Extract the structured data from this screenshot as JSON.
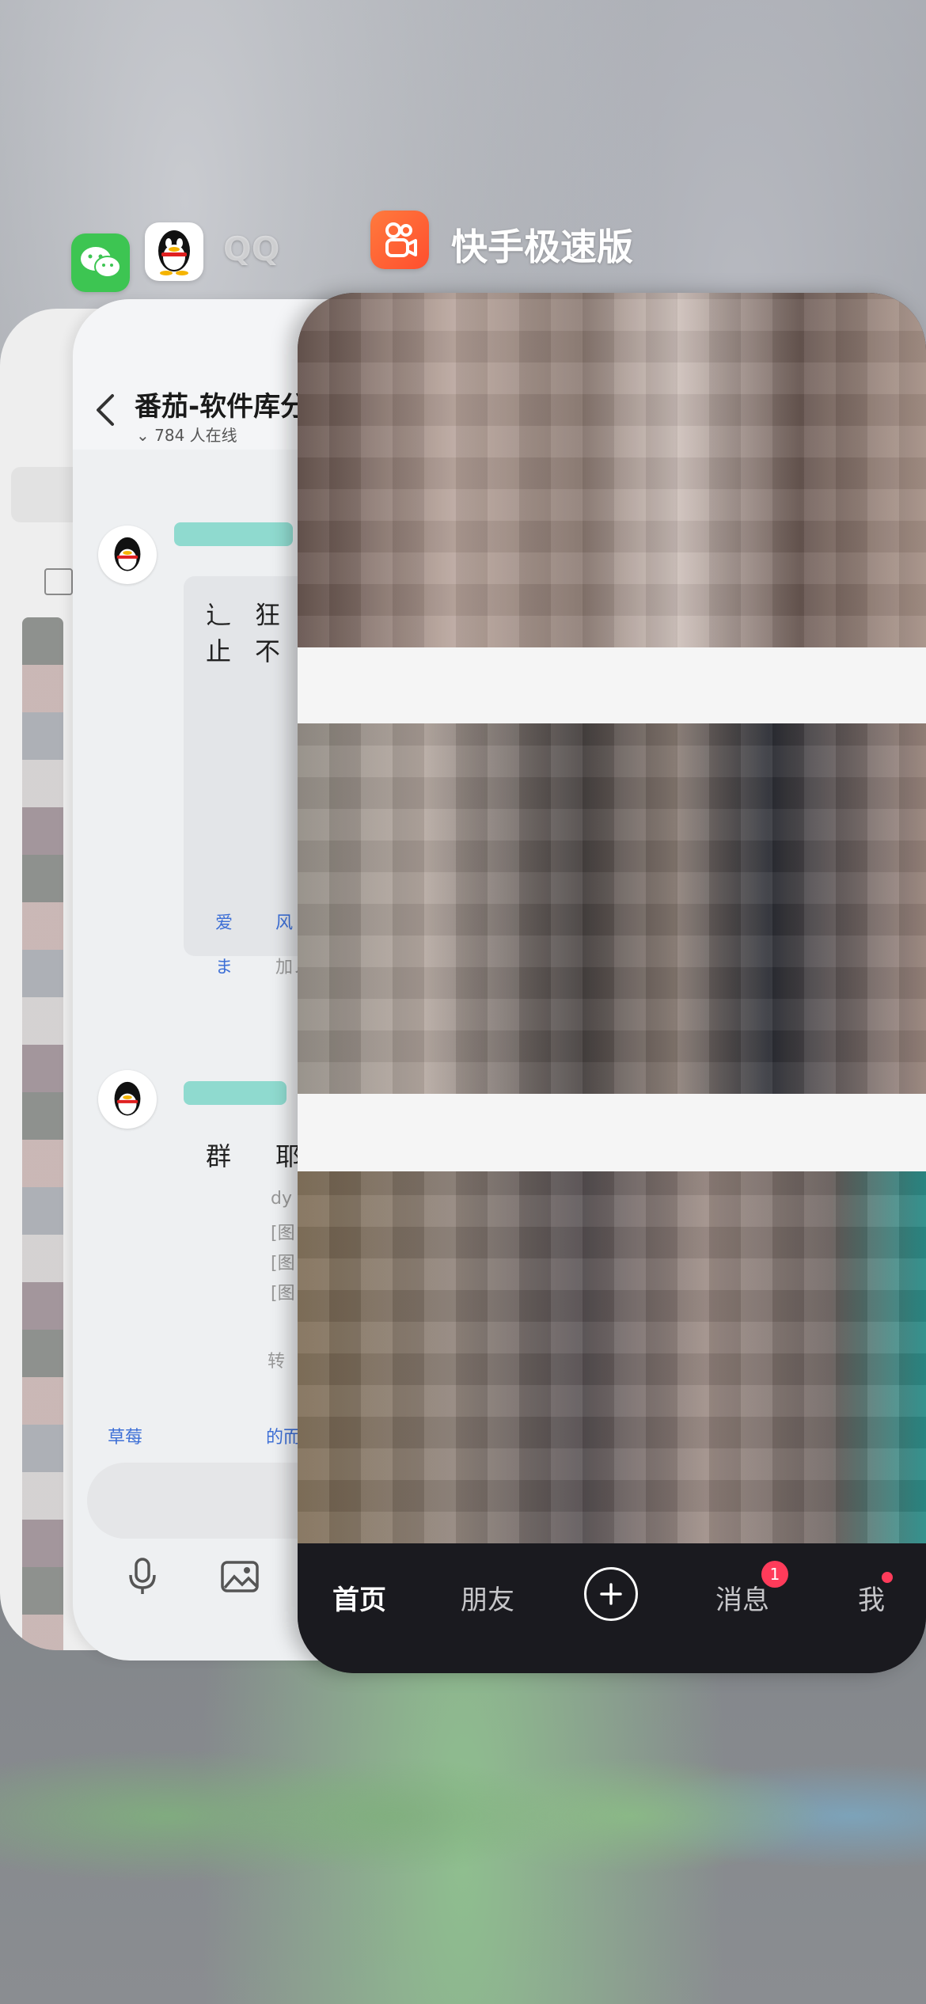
{
  "app_switcher": {
    "apps": [
      {
        "name": "",
        "icon": "wechat-icon"
      },
      {
        "name": "QQ",
        "icon": "qq-penguin-icon"
      },
      {
        "name": "快手极速版",
        "icon": "kuaishou-icon"
      }
    ]
  },
  "qq_chat": {
    "title": "番茄-软件库分",
    "online_count": "784 人在线",
    "link_text_1": "爱",
    "link_text_2": "风",
    "link_text_3": "ま",
    "link_text_4": "加ノ",
    "msg_text_1": "止",
    "msg_text_2": "不",
    "msg_text_3": "辶",
    "msg_text_4": "狂",
    "group_text": "群",
    "group_text_2": "耶",
    "list_item_1": "dy",
    "list_item_2": "[图",
    "list_item_3": "[图",
    "list_item_4": "[图",
    "forward_text": "转",
    "footer_link": "草莓",
    "footer_link_2": "的而"
  },
  "kuaishou": {
    "tabs": {
      "home": "首页",
      "friends": "朋友",
      "messages": "消息",
      "me": "我"
    },
    "message_badge": "1"
  },
  "colors": {
    "kuaishou_accent": "#ff4e2e",
    "badge_red": "#ff3b5a",
    "tabbar_bg": "#1a1a1f",
    "wechat_green": "#3dc552"
  }
}
